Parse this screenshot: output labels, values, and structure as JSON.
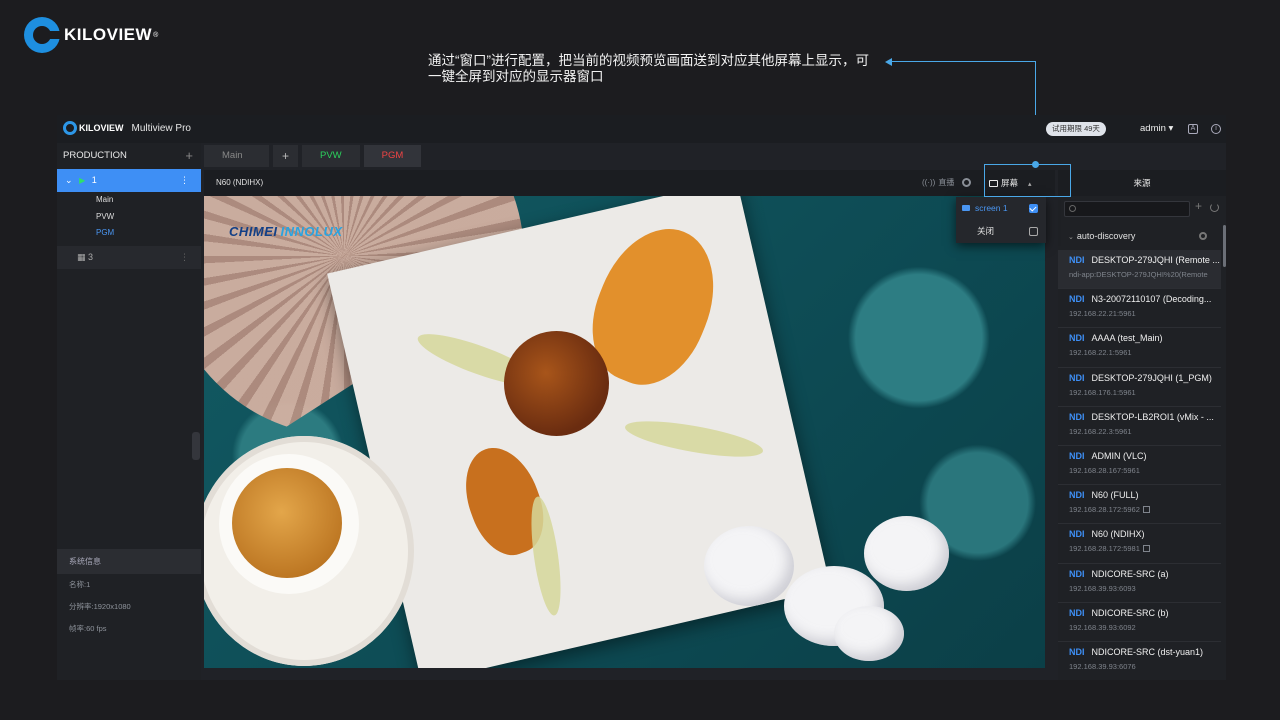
{
  "slide": {
    "brand": "KILOVIEW",
    "brand_reg": "®",
    "annotation": "通过“窗口”进行配置，把当前的视频预览画面送到对应其他屏幕上显示，可一键全屏到对应的显示器窗口"
  },
  "app": {
    "logo": "KILOVIEW",
    "title": "Multiview Pro",
    "trial_badge": "试用期限 49天",
    "user": "admin ▾",
    "header_icon_a": "A",
    "header_icon_b": "i"
  },
  "left": {
    "section": "PRODUCTION",
    "add": "+",
    "tree": {
      "item1": "1",
      "subitems": [
        "Main",
        "PVW",
        "PGM"
      ],
      "item3": "3",
      "kebab": "⋮"
    },
    "sysinfo": {
      "title": "系统信息",
      "name": "名称:1",
      "resolution": "分辨率:1920x1080",
      "framerate": "帧率:60 fps"
    }
  },
  "tabs": [
    {
      "label": "Main",
      "color": "#888888"
    },
    {
      "label": "+",
      "color": "#bbbbbb"
    },
    {
      "label": "PVW",
      "color": "#2bd05c"
    },
    {
      "label": "PGM",
      "color": "#f04444"
    }
  ],
  "center": {
    "source_label": "N60 (NDIHX)",
    "live_label": "直播",
    "screen_label": "屏幕",
    "caret": "▴",
    "watermark_a": "CHIMEI",
    "watermark_b": "INNOLUX"
  },
  "dropdown": {
    "items": [
      {
        "label": "screen 1",
        "checked": true
      },
      {
        "label": "关闭",
        "checked": false
      }
    ]
  },
  "right": {
    "title": "来源",
    "add": "+",
    "group": "auto-discovery",
    "group_chevron": "⌄",
    "sources": [
      {
        "tag": "NDI",
        "name": "DESKTOP-279JQHI (Remote ...",
        "addr": "ndi-app:DESKTOP-279JQHI%20(Remote"
      },
      {
        "tag": "NDI",
        "name": "N3-20072110107 (Decoding...",
        "addr": "192.168.22.21:5961"
      },
      {
        "tag": "NDI",
        "name": "AAAA (test_Main)",
        "addr": "192.168.22.1:5961"
      },
      {
        "tag": "NDI",
        "name": "DESKTOP-279JQHI (1_PGM)",
        "addr": "192.168.176.1:5961"
      },
      {
        "tag": "NDI",
        "name": "DESKTOP-LB2ROI1 (vMix - ...",
        "addr": "192.168.22.3:5961"
      },
      {
        "tag": "NDI",
        "name": "ADMIN (VLC)",
        "addr": "192.168.28.167:5961"
      },
      {
        "tag": "NDI",
        "name": "N60 (FULL)",
        "addr": "192.168.28.172:5962"
      },
      {
        "tag": "NDI",
        "name": "N60 (NDIHX)",
        "addr": "192.168.28.172:5981"
      },
      {
        "tag": "NDI",
        "name": "NDICORE-SRC (a)",
        "addr": "192.168.39.93:6093"
      },
      {
        "tag": "NDI",
        "name": "NDICORE-SRC (b)",
        "addr": "192.168.39.93:6092"
      },
      {
        "tag": "NDI",
        "name": "NDICORE-SRC (dst-yuan1)",
        "addr": "192.168.39.93:6076"
      }
    ]
  },
  "colors": {
    "accent": "#3e8ff5",
    "callout": "#4aa8e8",
    "pvw": "#2bd05c",
    "pgm": "#f04444"
  }
}
